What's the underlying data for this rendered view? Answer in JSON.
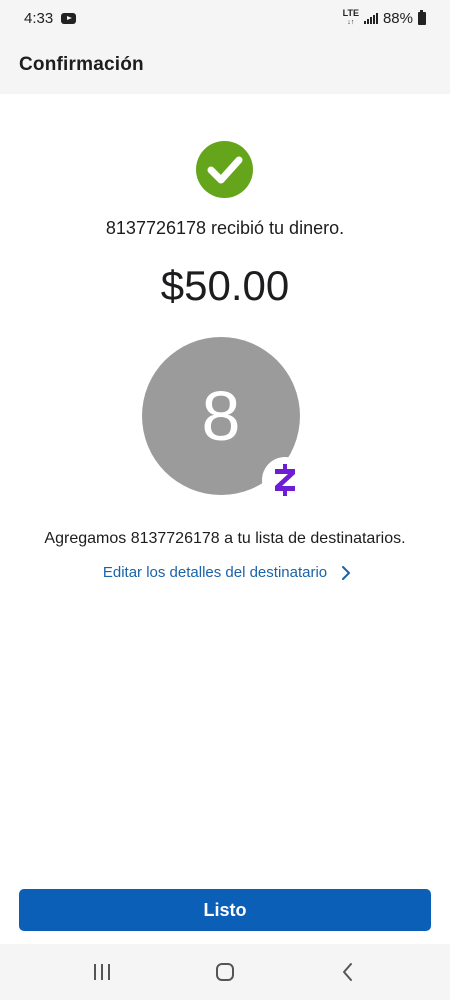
{
  "status_bar": {
    "time": "4:33",
    "network": "LTE",
    "battery": "88%"
  },
  "header": {
    "title": "Confirmación"
  },
  "confirmation": {
    "received_message": "8137726178 recibió tu dinero.",
    "amount": "$50.00",
    "avatar_initial": "8",
    "added_message": "Agregamos 8137726178 a tu lista de destinatarios.",
    "edit_link": "Editar los detalles del destinatario"
  },
  "actions": {
    "done_label": "Listo"
  },
  "colors": {
    "success_green": "#64a51b",
    "primary_blue": "#0b5fb7",
    "link_blue": "#1b63a8",
    "zelle_purple": "#6d1ed4",
    "avatar_gray": "#9b9b9b"
  },
  "icons": {
    "status": [
      "youtube-icon",
      "signal-icon",
      "battery-icon"
    ],
    "nav": [
      "recent-apps-icon",
      "home-icon",
      "back-icon"
    ]
  }
}
